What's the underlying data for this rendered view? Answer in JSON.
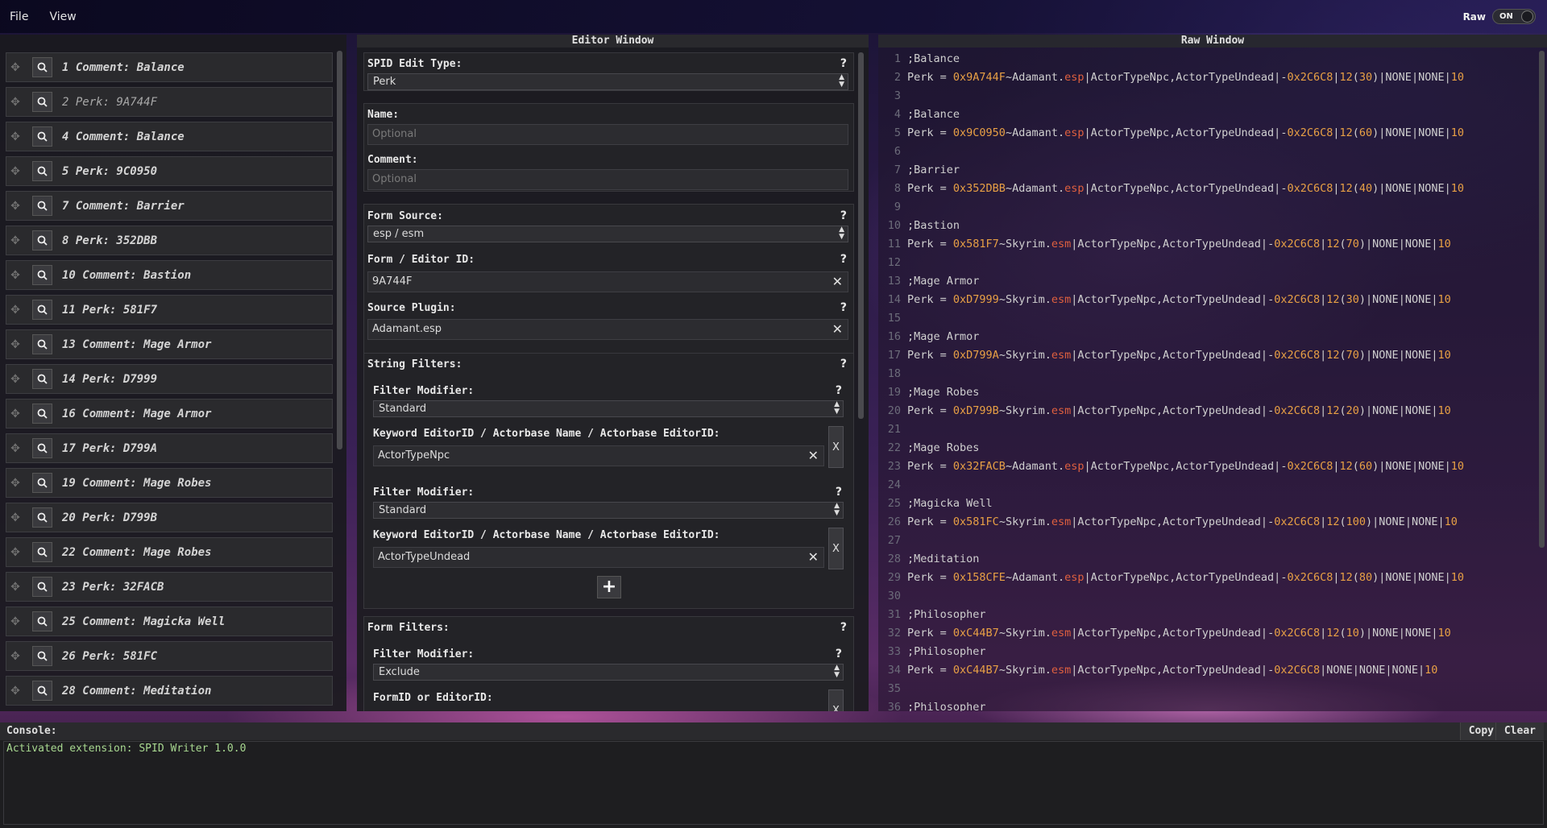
{
  "menu": {
    "file": "File",
    "view": "View",
    "raw_label": "Raw",
    "raw_toggle": "ON"
  },
  "list_items": [
    "1 Comment: Balance",
    "2 Perk: 9A744F",
    "4 Comment: Balance",
    "5 Perk: 9C0950",
    "7 Comment: Barrier",
    "8 Perk: 352DBB",
    "10 Comment: Bastion",
    "11 Perk: 581F7",
    "13 Comment: Mage Armor",
    "14 Perk: D7999",
    "16 Comment: Mage Armor",
    "17 Perk: D799A",
    "19 Comment: Mage Robes",
    "20 Perk: D799B",
    "22 Comment: Mage Robes",
    "23 Perk: 32FACB",
    "25 Comment: Magicka Well",
    "26 Perk: 581FC",
    "28 Comment: Meditation"
  ],
  "editor": {
    "title": "Editor Window",
    "help": "?",
    "edit_type_label": "SPID Edit Type:",
    "edit_type_value": "Perk",
    "name_label": "Name:",
    "name_placeholder": "Optional",
    "comment_label": "Comment:",
    "comment_placeholder": "Optional",
    "form_source_label": "Form Source:",
    "form_source_value": "esp / esm",
    "form_id_label": "Form / Editor ID:",
    "form_id_value": "9A744F",
    "source_plugin_label": "Source Plugin:",
    "source_plugin_value": "Adamant.esp",
    "string_filters_label": "String Filters:",
    "filter_modifier_label": "Filter Modifier:",
    "filter1_modifier": "Standard",
    "keyword_label": "Keyword EditorID / Actorbase Name / Actorbase EditorID:",
    "filter1_keyword": "ActorTypeNpc",
    "filter2_modifier": "Standard",
    "filter2_keyword": "ActorTypeUndead",
    "remove_label": "X",
    "add_label": "+",
    "form_filters_label": "Form Filters:",
    "form_filter_modifier": "Exclude",
    "formid_label": "FormID or EditorID:"
  },
  "raw": {
    "title": "Raw Window",
    "lines": [
      {
        "n": "1",
        "c": ";Balance"
      },
      {
        "n": "2",
        "p": "Perk = ",
        "h": "0x9A744F",
        "m": "~Adamant.",
        "e": "esp",
        "r": "|ActorTypeNpc,ActorTypeUndead|-",
        "g": "0x2C6C8",
        "s": "|",
        "l": "12",
        "t": "(",
        "v": "30",
        "u": ")|NONE|NONE|",
        "w": "10"
      },
      {
        "n": "3",
        "c": ""
      },
      {
        "n": "4",
        "c": ";Balance"
      },
      {
        "n": "5",
        "p": "Perk = ",
        "h": "0x9C0950",
        "m": "~Adamant.",
        "e": "esp",
        "r": "|ActorTypeNpc,ActorTypeUndead|-",
        "g": "0x2C6C8",
        "s": "|",
        "l": "12",
        "t": "(",
        "v": "60",
        "u": ")|NONE|NONE|",
        "w": "10"
      },
      {
        "n": "6",
        "c": ""
      },
      {
        "n": "7",
        "c": ";Barrier"
      },
      {
        "n": "8",
        "p": "Perk = ",
        "h": "0x352DBB",
        "m": "~Adamant.",
        "e": "esp",
        "r": "|ActorTypeNpc,ActorTypeUndead|-",
        "g": "0x2C6C8",
        "s": "|",
        "l": "12",
        "t": "(",
        "v": "40",
        "u": ")|NONE|NONE|",
        "w": "10"
      },
      {
        "n": "9",
        "c": ""
      },
      {
        "n": "10",
        "c": ";Bastion"
      },
      {
        "n": "11",
        "p": "Perk = ",
        "h": "0x581F7",
        "m": "~Skyrim.",
        "e": "esm",
        "r": "|ActorTypeNpc,ActorTypeUndead|-",
        "g": "0x2C6C8",
        "s": "|",
        "l": "12",
        "t": "(",
        "v": "70",
        "u": ")|NONE|NONE|",
        "w": "10"
      },
      {
        "n": "12",
        "c": ""
      },
      {
        "n": "13",
        "c": ";Mage Armor"
      },
      {
        "n": "14",
        "p": "Perk = ",
        "h": "0xD7999",
        "m": "~Skyrim.",
        "e": "esm",
        "r": "|ActorTypeNpc,ActorTypeUndead|-",
        "g": "0x2C6C8",
        "s": "|",
        "l": "12",
        "t": "(",
        "v": "30",
        "u": ")|NONE|NONE|",
        "w": "10"
      },
      {
        "n": "15",
        "c": ""
      },
      {
        "n": "16",
        "c": ";Mage Armor"
      },
      {
        "n": "17",
        "p": "Perk = ",
        "h": "0xD799A",
        "m": "~Skyrim.",
        "e": "esm",
        "r": "|ActorTypeNpc,ActorTypeUndead|-",
        "g": "0x2C6C8",
        "s": "|",
        "l": "12",
        "t": "(",
        "v": "70",
        "u": ")|NONE|NONE|",
        "w": "10"
      },
      {
        "n": "18",
        "c": ""
      },
      {
        "n": "19",
        "c": ";Mage Robes"
      },
      {
        "n": "20",
        "p": "Perk = ",
        "h": "0xD799B",
        "m": "~Skyrim.",
        "e": "esm",
        "r": "|ActorTypeNpc,ActorTypeUndead|-",
        "g": "0x2C6C8",
        "s": "|",
        "l": "12",
        "t": "(",
        "v": "20",
        "u": ")|NONE|NONE|",
        "w": "10"
      },
      {
        "n": "21",
        "c": ""
      },
      {
        "n": "22",
        "c": ";Mage Robes"
      },
      {
        "n": "23",
        "p": "Perk = ",
        "h": "0x32FACB",
        "m": "~Adamant.",
        "e": "esp",
        "r": "|ActorTypeNpc,ActorTypeUndead|-",
        "g": "0x2C6C8",
        "s": "|",
        "l": "12",
        "t": "(",
        "v": "60",
        "u": ")|NONE|NONE|",
        "w": "10"
      },
      {
        "n": "24",
        "c": ""
      },
      {
        "n": "25",
        "c": ";Magicka Well"
      },
      {
        "n": "26",
        "p": "Perk = ",
        "h": "0x581FC",
        "m": "~Skyrim.",
        "e": "esm",
        "r": "|ActorTypeNpc,ActorTypeUndead|-",
        "g": "0x2C6C8",
        "s": "|",
        "l": "12",
        "t": "(",
        "v": "100",
        "u": ")|NONE|NONE|",
        "w": "10"
      },
      {
        "n": "27",
        "c": ""
      },
      {
        "n": "28",
        "c": ";Meditation"
      },
      {
        "n": "29",
        "p": "Perk = ",
        "h": "0x158CFE",
        "m": "~Adamant.",
        "e": "esp",
        "r": "|ActorTypeNpc,ActorTypeUndead|-",
        "g": "0x2C6C8",
        "s": "|",
        "l": "12",
        "t": "(",
        "v": "80",
        "u": ")|NONE|NONE|",
        "w": "10"
      },
      {
        "n": "30",
        "c": ""
      },
      {
        "n": "31",
        "c": ";Philosopher"
      },
      {
        "n": "32",
        "p": "Perk = ",
        "h": "0xC44B7",
        "m": "~Skyrim.",
        "e": "esm",
        "r": "|ActorTypeNpc,ActorTypeUndead|-",
        "g": "0x2C6C8",
        "s": "|",
        "l": "12",
        "t": "(",
        "v": "10",
        "u": ")|NONE|NONE|",
        "w": "10"
      },
      {
        "n": "33",
        "c": ";Philosopher"
      },
      {
        "n": "34",
        "p": "Perk = ",
        "h": "0xC44B7",
        "m": "~Skyrim.",
        "e": "esm",
        "r": "|ActorTypeNpc,ActorTypeUndead|-",
        "g": "0x2C6C8",
        "s": "|NONE|NONE|NONE|",
        "l": "",
        "t": "",
        "v": "",
        "u": "",
        "w": "10"
      },
      {
        "n": "35",
        "c": ""
      },
      {
        "n": "36",
        "c": ";Philosopher"
      }
    ]
  },
  "console": {
    "title": "Console:",
    "copy": "Copy",
    "clear": "Clear",
    "message": "Activated extension: SPID Writer 1.0.0"
  },
  "colors": {
    "hex": "#e8a045",
    "ext": "#e0603f",
    "console_msg": "#a8d890"
  }
}
